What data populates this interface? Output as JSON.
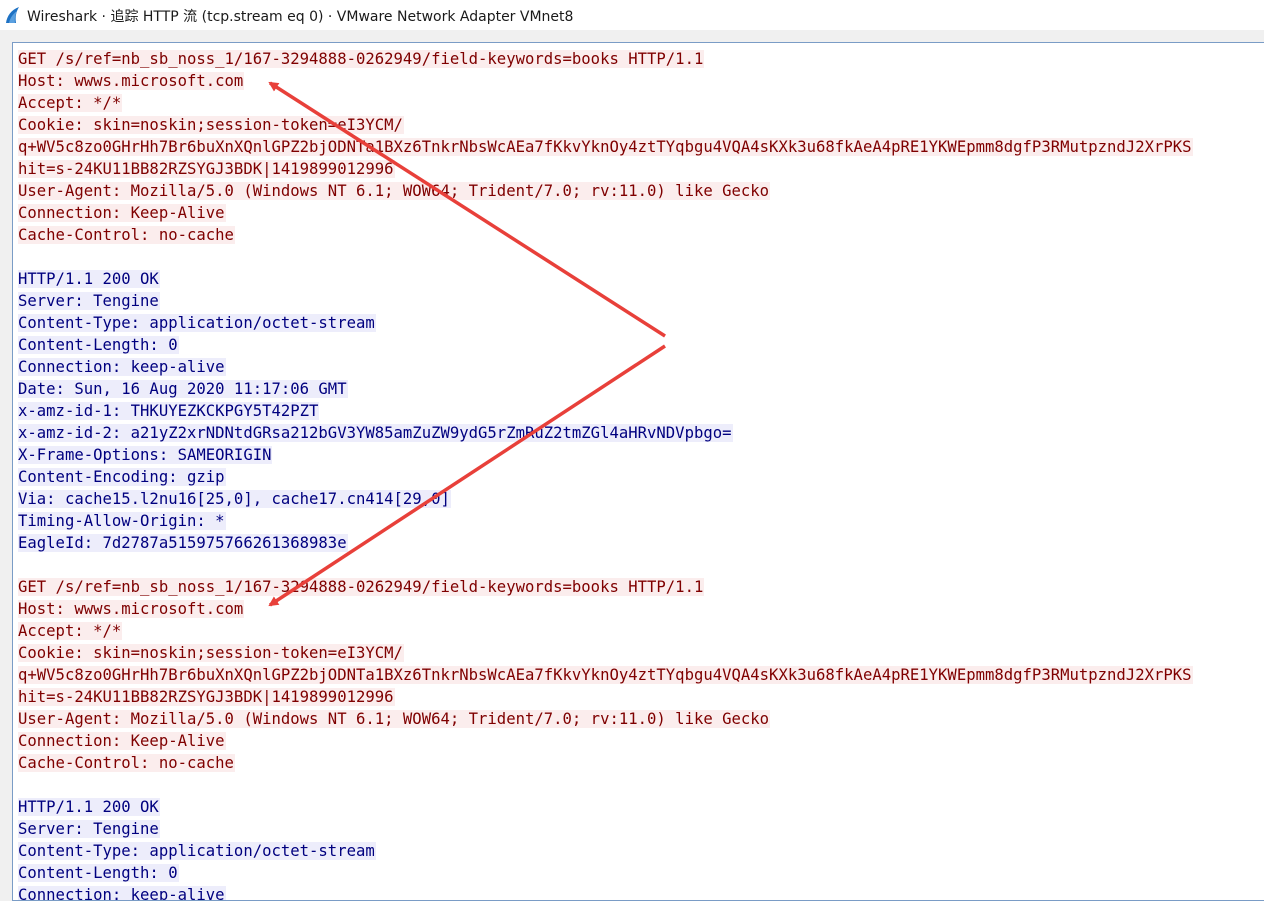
{
  "window": {
    "title": "Wireshark · 追踪 HTTP 流 (tcp.stream eq 0) · VMware Network Adapter VMnet8",
    "icon": "wireshark-fin-icon",
    "accent_color": "#1e72c4"
  },
  "colors": {
    "client_bg": "#fbeded",
    "client_fg": "#7f0000",
    "server_bg": "#ededfb",
    "server_fg": "#00007f",
    "annotation": "#e8403a"
  },
  "stream": {
    "blocks": [
      {
        "direction": "client",
        "lines": [
          "GET /s/ref=nb_sb_noss_1/167-3294888-0262949/field-keywords=books HTTP/1.1",
          "Host: wwws.microsoft.com",
          "Accept: */*",
          "Cookie: skin=noskin;session-token=eI3YCM/",
          "q+WV5c8zo0GHrHh7Br6buXnXQnlGPZ2bjODNTa1BXz6TnkrNbsWcAEa7fKkvYknOy4ztTYqbgu4VQA4sKXk3u68fkAeA4pRE1YKWEpmm8dgfP3RMutpzndJ2XrPKS",
          "hit=s-24KU11BB82RZSYGJ3BDK|1419899012996",
          "User-Agent: Mozilla/5.0 (Windows NT 6.1; WOW64; Trident/7.0; rv:11.0) like Gecko",
          "Connection: Keep-Alive",
          "Cache-Control: no-cache"
        ]
      },
      {
        "direction": "server",
        "lines": [
          "HTTP/1.1 200 OK",
          "Server: Tengine",
          "Content-Type: application/octet-stream",
          "Content-Length: 0",
          "Connection: keep-alive",
          "Date: Sun, 16 Aug 2020 11:17:06 GMT",
          "x-amz-id-1: THKUYEZKCKPGY5T42PZT",
          "x-amz-id-2: a21yZ2xrNDNtdGRsa212bGV3YW85amZuZW9ydG5rZmRuZ2tmZGl4aHRvNDVpbgo=",
          "X-Frame-Options: SAMEORIGIN",
          "Content-Encoding: gzip",
          "Via: cache15.l2nu16[25,0], cache17.cn414[29,0]",
          "Timing-Allow-Origin: *",
          "EagleId: 7d2787a515975766261368983e"
        ]
      },
      {
        "direction": "client",
        "lines": [
          "GET /s/ref=nb_sb_noss_1/167-3294888-0262949/field-keywords=books HTTP/1.1",
          "Host: wwws.microsoft.com",
          "Accept: */*",
          "Cookie: skin=noskin;session-token=eI3YCM/",
          "q+WV5c8zo0GHrHh7Br6buXnXQnlGPZ2bjODNTa1BXz6TnkrNbsWcAEa7fKkvYknOy4ztTYqbgu4VQA4sKXk3u68fkAeA4pRE1YKWEpmm8dgfP3RMutpzndJ2XrPKS",
          "hit=s-24KU11BB82RZSYGJ3BDK|1419899012996",
          "User-Agent: Mozilla/5.0 (Windows NT 6.1; WOW64; Trident/7.0; rv:11.0) like Gecko",
          "Connection: Keep-Alive",
          "Cache-Control: no-cache"
        ]
      },
      {
        "direction": "server",
        "lines": [
          "HTTP/1.1 200 OK",
          "Server: Tengine",
          "Content-Type: application/octet-stream",
          "Content-Length: 0",
          "Connection: keep-alive"
        ]
      }
    ]
  },
  "annotation": {
    "type": "red-arrows",
    "targets": [
      "first Host header",
      "second Host header"
    ]
  }
}
